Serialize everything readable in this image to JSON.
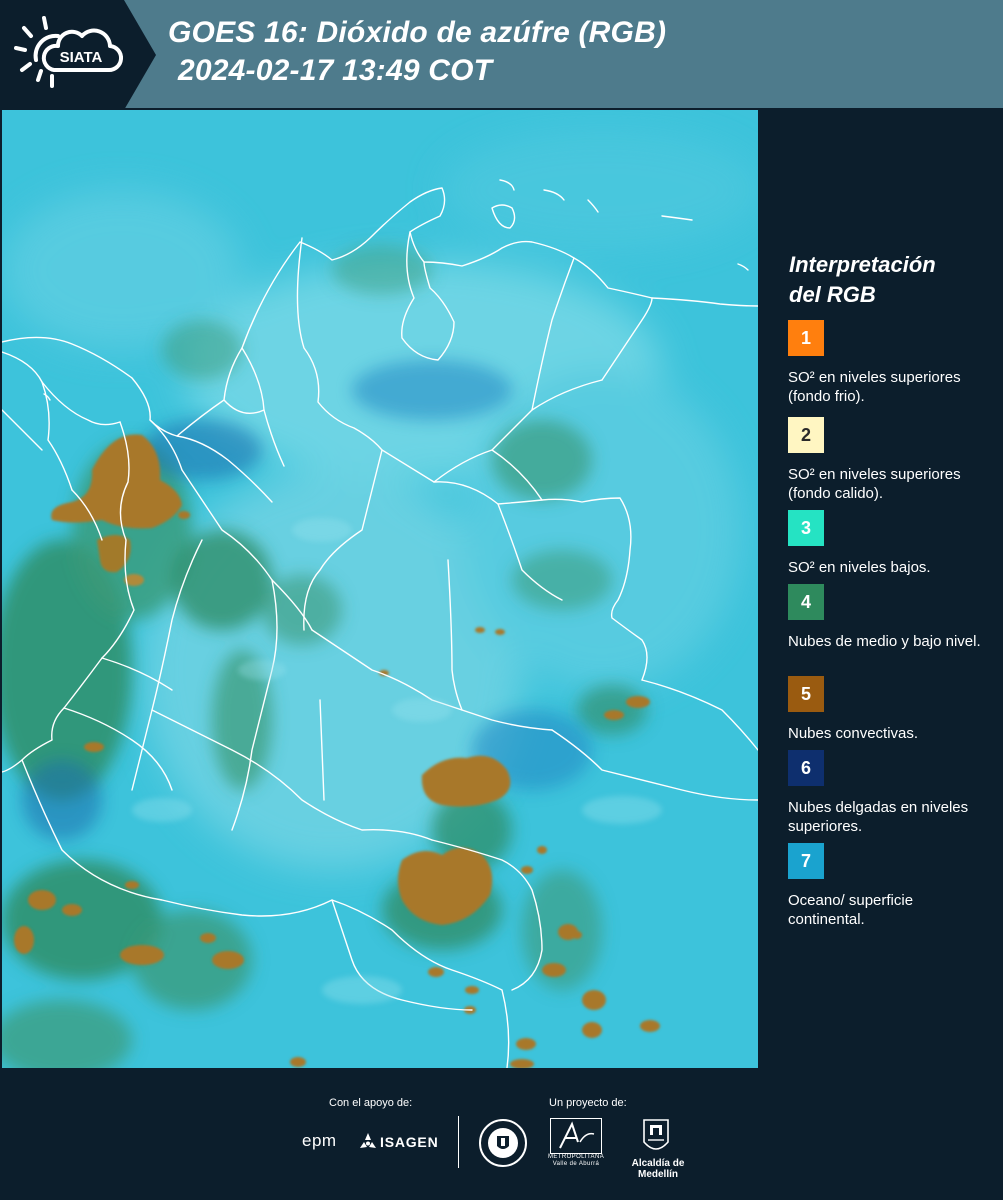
{
  "header": {
    "logo_text": "SIATA",
    "title_line1": "GOES 16: Dióxido de azúfre (RGB)",
    "title_line2": "2024-02-17 13:49 COT"
  },
  "legend": {
    "title_line1": "Interpretación",
    "title_line2": "del RGB",
    "items": [
      {
        "number": "1",
        "color": "#ff7f0e",
        "text": "SO² en niveles superiores (fondo frio)."
      },
      {
        "number": "2",
        "color": "#fff6c2",
        "text": "SO² en niveles superiores (fondo calido)."
      },
      {
        "number": "3",
        "color": "#25e3c3",
        "text": "SO² en niveles bajos."
      },
      {
        "number": "4",
        "color": "#2e8a5d",
        "text": "Nubes de medio y bajo nivel."
      },
      {
        "number": "5",
        "color": "#9a5b10",
        "text": "Nubes convectivas."
      },
      {
        "number": "6",
        "color": "#0e2f6e",
        "text": "Nubes delgadas en niveles superiores."
      },
      {
        "number": "7",
        "color": "#1aa3cf",
        "text": "Oceano/ superficie continental."
      }
    ]
  },
  "footer": {
    "support_label": "Con el apoyo de:",
    "project_label": "Un proyecto de:",
    "epm": "epm",
    "isagen": "ISAGEN",
    "area_name": "METROPOLITANA",
    "area_sub": "Valle de Aburrá",
    "alcaldia": "Alcaldía de Medellín"
  },
  "map_colors": {
    "background": "#3fc6dc",
    "land_tint": "#58cfe0",
    "low_clouds": "#2f8f6a",
    "convective": "#a27a2c",
    "borders": "#ffffff"
  }
}
